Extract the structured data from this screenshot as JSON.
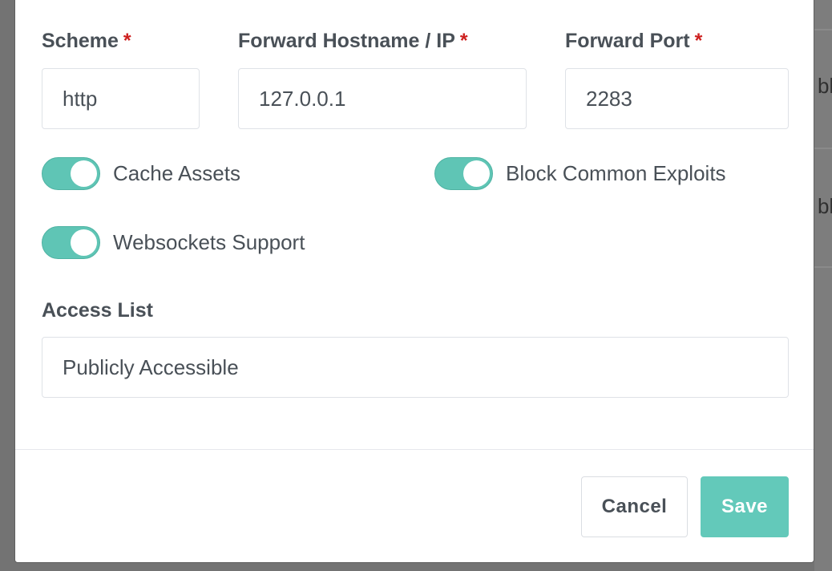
{
  "background": {
    "partial_text_1": "bl",
    "partial_text_2": "bl"
  },
  "form": {
    "scheme": {
      "label": "Scheme",
      "required_mark": "*",
      "value": "http"
    },
    "forward_host": {
      "label": "Forward Hostname / IP",
      "required_mark": "*",
      "value": "127.0.0.1"
    },
    "forward_port": {
      "label": "Forward Port",
      "required_mark": "*",
      "value": "2283"
    },
    "toggles": [
      {
        "label": "Cache Assets",
        "on": true
      },
      {
        "label": "Block Common Exploits",
        "on": true
      },
      {
        "label": "Websockets Support",
        "on": true
      }
    ],
    "access_list": {
      "label": "Access List",
      "value": "Publicly Accessible"
    }
  },
  "footer": {
    "cancel_label": "Cancel",
    "save_label": "Save"
  },
  "colors": {
    "accent": "#5fc5b5",
    "save_button": "#63c9ba",
    "required": "#cd201f",
    "overlay": "#737373"
  }
}
